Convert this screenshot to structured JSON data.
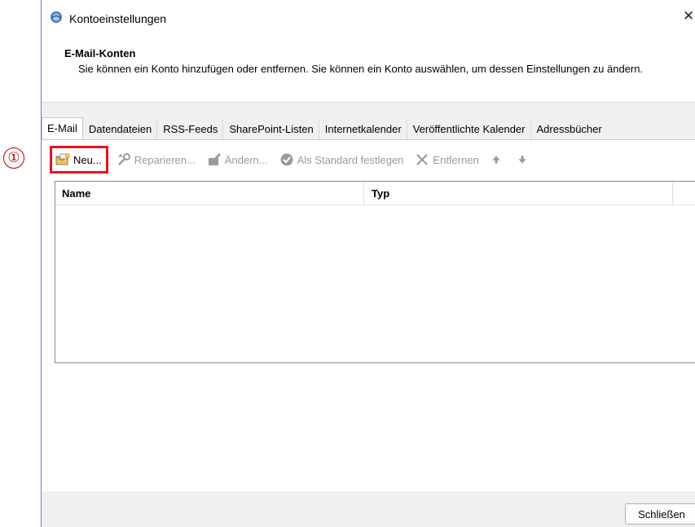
{
  "annotation": {
    "step_marker": "①",
    "marker_color": "#c00000",
    "highlight_color": "#e8111a"
  },
  "window": {
    "title": "Kontoeinstellungen",
    "close_glyph": "✕"
  },
  "header": {
    "title": "E-Mail-Konten",
    "description": "Sie können ein Konto hinzufügen oder entfernen. Sie können ein Konto auswählen, um dessen Einstellungen zu ändern."
  },
  "tabs": [
    {
      "label": "E-Mail",
      "active": true
    },
    {
      "label": "Datendateien"
    },
    {
      "label": "RSS-Feeds"
    },
    {
      "label": "SharePoint-Listen"
    },
    {
      "label": "Internetkalender"
    },
    {
      "label": "Veröffentlichte Kalender"
    },
    {
      "label": "Adressbücher"
    }
  ],
  "toolbar": {
    "new_label": "Neu...",
    "repair_label": "Reparieren...",
    "change_label": "Ändern...",
    "default_label": "Als Standard festlegen",
    "remove_label": "Entfernen",
    "icons": [
      "new-account-icon",
      "repair-icon",
      "change-icon",
      "check-circle-icon",
      "remove-x-icon",
      "arrow-up-icon",
      "arrow-down-icon"
    ]
  },
  "list": {
    "columns": [
      "Name",
      "Typ"
    ],
    "rows": []
  },
  "footer": {
    "close_label": "Schließen"
  }
}
